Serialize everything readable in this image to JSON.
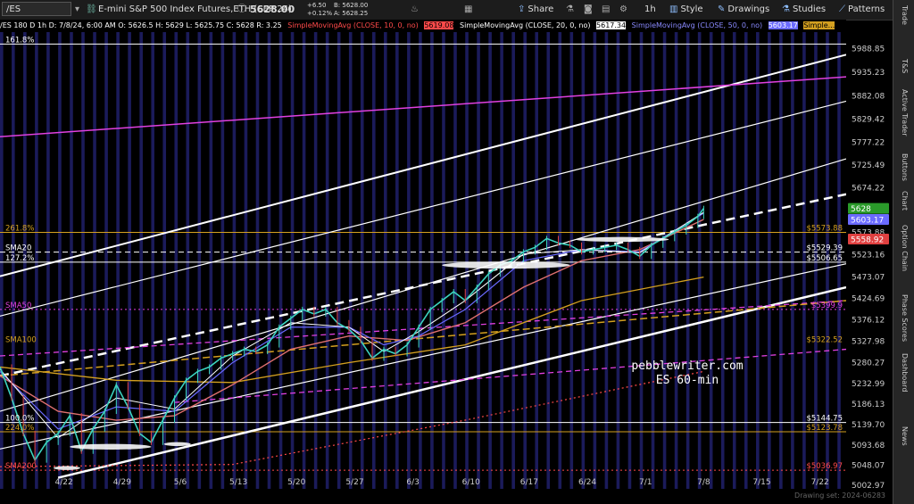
{
  "toolbar": {
    "symbol": "/ES",
    "description": "E-mini S&P 500 Index Futures,ETH (SEP 24)",
    "last_price": "5628.00",
    "change": "+6.50",
    "change_pct": "+0.12%",
    "bid": "B: 5628.00",
    "ask": "A: 5628.25",
    "share_label": "Share",
    "timeframe_label": "1h",
    "style_label": "Style",
    "drawings_label": "Drawings",
    "studies_label": "Studies",
    "patterns_label": "Patterns"
  },
  "infobar": {
    "ohlc": "/ES 180 D 1h   D: 7/8/24, 6:00 AM  O: 5626.5  H: 5629  L: 5625.75  C: 5628  R: 3.25",
    "sma10_label": "SimpleMovingAvg (CLOSE, 10, 0, no)",
    "sma10_value": "5619.08",
    "sma20_label": "SimpleMovingAvg (CLOSE, 20, 0, no)",
    "sma20_value": "5617.34",
    "sma50_label": "SimpleMovingAvg (CLOSE, 50, 0, no)",
    "sma50_value": "5603.17",
    "sma_more_label": "Simple..."
  },
  "right_tabs": [
    "Trade",
    "T&S",
    "Active Trader",
    "Buttons",
    "Chart",
    "Option Chain",
    "Phase Scores",
    "Dashboard",
    "News"
  ],
  "footer": {
    "drawing_set": "Drawing set: 2024-06283"
  },
  "colors": {
    "bg": "#000000",
    "stripe": "#1b1b5a",
    "white": "#ffffff",
    "magenta": "#e040e0",
    "gold": "#d4a020",
    "red": "#ff4a4a",
    "candle_up": "#3cd3c0",
    "candle_dn": "#e04040"
  },
  "chart_data": {
    "type": "line",
    "title": "",
    "watermark": [
      "pebblewriter.com",
      "ES 60-min"
    ],
    "x_ticks": [
      "4/22",
      "4/29",
      "5/6",
      "5/13",
      "5/20",
      "5/27",
      "6/3",
      "6/10",
      "6/17",
      "6/24",
      "7/1",
      "7/8",
      "7/15",
      "7/22"
    ],
    "x_tick_index": [
      11,
      21,
      31,
      41,
      51,
      61,
      71,
      81,
      91,
      101,
      111,
      121,
      131,
      141
    ],
    "y_axis_ticks": [
      5988.85,
      5935.23,
      5882.08,
      5829.42,
      5777.22,
      5725.49,
      5674.22,
      5623.41,
      5573.88,
      5523.16,
      5473.07,
      5424.69,
      5376.12,
      5327.98,
      5280.27,
      5232.99,
      5186.13,
      5139.7,
      5093.68,
      5048.07,
      5002.97
    ],
    "ylim": [
      4995,
      6026
    ],
    "xlim": [
      0,
      145.5
    ],
    "close_series": [
      {
        "x": 0,
        "y": 5270
      },
      {
        "x": 2,
        "y": 5200
      },
      {
        "x": 4,
        "y": 5120
      },
      {
        "x": 6,
        "y": 5060
      },
      {
        "x": 8,
        "y": 5100
      },
      {
        "x": 10,
        "y": 5120
      },
      {
        "x": 12,
        "y": 5160
      },
      {
        "x": 14,
        "y": 5080
      },
      {
        "x": 16,
        "y": 5130
      },
      {
        "x": 18,
        "y": 5170
      },
      {
        "x": 20,
        "y": 5230
      },
      {
        "x": 22,
        "y": 5180
      },
      {
        "x": 24,
        "y": 5120
      },
      {
        "x": 26,
        "y": 5100
      },
      {
        "x": 28,
        "y": 5150
      },
      {
        "x": 30,
        "y": 5200
      },
      {
        "x": 32,
        "y": 5240
      },
      {
        "x": 34,
        "y": 5260
      },
      {
        "x": 36,
        "y": 5270
      },
      {
        "x": 38,
        "y": 5290
      },
      {
        "x": 40,
        "y": 5300
      },
      {
        "x": 42,
        "y": 5310
      },
      {
        "x": 44,
        "y": 5305
      },
      {
        "x": 46,
        "y": 5320
      },
      {
        "x": 48,
        "y": 5360
      },
      {
        "x": 50,
        "y": 5380
      },
      {
        "x": 52,
        "y": 5400
      },
      {
        "x": 54,
        "y": 5390
      },
      {
        "x": 56,
        "y": 5400
      },
      {
        "x": 58,
        "y": 5370
      },
      {
        "x": 60,
        "y": 5355
      },
      {
        "x": 62,
        "y": 5330
      },
      {
        "x": 64,
        "y": 5290
      },
      {
        "x": 66,
        "y": 5310
      },
      {
        "x": 68,
        "y": 5300
      },
      {
        "x": 70,
        "y": 5320
      },
      {
        "x": 72,
        "y": 5360
      },
      {
        "x": 74,
        "y": 5400
      },
      {
        "x": 76,
        "y": 5420
      },
      {
        "x": 78,
        "y": 5440
      },
      {
        "x": 80,
        "y": 5420
      },
      {
        "x": 82,
        "y": 5450
      },
      {
        "x": 84,
        "y": 5480
      },
      {
        "x": 86,
        "y": 5500
      },
      {
        "x": 88,
        "y": 5510
      },
      {
        "x": 90,
        "y": 5530
      },
      {
        "x": 92,
        "y": 5540
      },
      {
        "x": 94,
        "y": 5560
      },
      {
        "x": 96,
        "y": 5550
      },
      {
        "x": 98,
        "y": 5545
      },
      {
        "x": 100,
        "y": 5530
      },
      {
        "x": 102,
        "y": 5535
      },
      {
        "x": 104,
        "y": 5540
      },
      {
        "x": 106,
        "y": 5545
      },
      {
        "x": 108,
        "y": 5535
      },
      {
        "x": 110,
        "y": 5520
      },
      {
        "x": 112,
        "y": 5545
      },
      {
        "x": 114,
        "y": 5560
      },
      {
        "x": 116,
        "y": 5575
      },
      {
        "x": 118,
        "y": 5590
      },
      {
        "x": 120,
        "y": 5610
      },
      {
        "x": 121,
        "y": 5628
      }
    ],
    "sma10": [
      {
        "x": 0,
        "y": 5265
      },
      {
        "x": 10,
        "y": 5110
      },
      {
        "x": 20,
        "y": 5200
      },
      {
        "x": 30,
        "y": 5175
      },
      {
        "x": 40,
        "y": 5295
      },
      {
        "x": 50,
        "y": 5370
      },
      {
        "x": 60,
        "y": 5360
      },
      {
        "x": 66,
        "y": 5305
      },
      {
        "x": 72,
        "y": 5350
      },
      {
        "x": 80,
        "y": 5420
      },
      {
        "x": 90,
        "y": 5525
      },
      {
        "x": 100,
        "y": 5535
      },
      {
        "x": 110,
        "y": 5528
      },
      {
        "x": 121,
        "y": 5619.08
      }
    ],
    "sma20": [
      {
        "x": 0,
        "y": 5260
      },
      {
        "x": 10,
        "y": 5130
      },
      {
        "x": 20,
        "y": 5180
      },
      {
        "x": 30,
        "y": 5170
      },
      {
        "x": 40,
        "y": 5280
      },
      {
        "x": 50,
        "y": 5360
      },
      {
        "x": 60,
        "y": 5360
      },
      {
        "x": 66,
        "y": 5320
      },
      {
        "x": 72,
        "y": 5340
      },
      {
        "x": 80,
        "y": 5400
      },
      {
        "x": 90,
        "y": 5510
      },
      {
        "x": 100,
        "y": 5535
      },
      {
        "x": 110,
        "y": 5530
      },
      {
        "x": 121,
        "y": 5617.34
      }
    ],
    "sma50": [
      {
        "x": 0,
        "y": 5250
      },
      {
        "x": 10,
        "y": 5170
      },
      {
        "x": 20,
        "y": 5150
      },
      {
        "x": 30,
        "y": 5160
      },
      {
        "x": 40,
        "y": 5230
      },
      {
        "x": 50,
        "y": 5310
      },
      {
        "x": 60,
        "y": 5340
      },
      {
        "x": 70,
        "y": 5330
      },
      {
        "x": 80,
        "y": 5370
      },
      {
        "x": 90,
        "y": 5450
      },
      {
        "x": 100,
        "y": 5510
      },
      {
        "x": 110,
        "y": 5535
      },
      {
        "x": 121,
        "y": 5603.17
      }
    ],
    "sma100": [
      {
        "x": 0,
        "y": 5270
      },
      {
        "x": 20,
        "y": 5240
      },
      {
        "x": 40,
        "y": 5235
      },
      {
        "x": 60,
        "y": 5280
      },
      {
        "x": 80,
        "y": 5320
      },
      {
        "x": 100,
        "y": 5420
      },
      {
        "x": 121,
        "y": 5473
      }
    ],
    "sma200": [
      {
        "x": 0,
        "y": 5045
      },
      {
        "x": 40,
        "y": 5050
      },
      {
        "x": 80,
        "y": 5150
      },
      {
        "x": 121,
        "y": 5260
      }
    ],
    "horizontal_levels": [
      {
        "label": "261.8%",
        "price_label": "$5573.88",
        "y": 5573.88,
        "color": "#d4a020",
        "side": "left",
        "style": "solid"
      },
      {
        "label": "SMA20",
        "price_label": "$5529.39",
        "y": 5529.39,
        "color": "#ffffff",
        "side": "left",
        "style": "dash"
      },
      {
        "label": "127.2%",
        "price_label": "$5506.65",
        "y": 5506.65,
        "color": "#ffffff",
        "side": "left",
        "style": "solid"
      },
      {
        "label": "SMA50",
        "price_label": "$5399.9",
        "y": 5399.9,
        "color": "#e040e0",
        "side": "left",
        "style": "dot"
      },
      {
        "label": "SMA100",
        "price_label": "$5322.52",
        "y": 5322.52,
        "color": "#d4a020",
        "side": "left",
        "style": "none"
      },
      {
        "label": "100.0%",
        "price_label": "$5144.75",
        "y": 5144.75,
        "color": "#ffffff",
        "side": "left",
        "style": "solid"
      },
      {
        "label": "224.0%",
        "price_label": "$5123.78",
        "y": 5123.78,
        "color": "#d4a020",
        "side": "left",
        "style": "solid"
      },
      {
        "label": "SMA200",
        "price_label": "$5036.97",
        "y": 5036.97,
        "color": "#ff4a4a",
        "side": "left",
        "style": "dot"
      },
      {
        "label": "161.8%",
        "price_label": "",
        "y": 5999,
        "color": "#ffffff",
        "side": "left",
        "style": "solid"
      }
    ],
    "price_badges": [
      {
        "text": "5628",
        "y": 5628,
        "bg": "#2a9a2a"
      },
      {
        "text": "5603.17",
        "y": 5603.17,
        "bg": "#6a6aff"
      },
      {
        "text": "5558.92",
        "y": 5558.92,
        "bg": "#e04040"
      }
    ],
    "channel_lines": [
      {
        "from": [
          0,
          5475
        ],
        "to": [
          145.5,
          5975
        ],
        "color": "#ffffff",
        "width": 2,
        "dash": "none"
      },
      {
        "from": [
          0,
          5250
        ],
        "to": [
          145.5,
          5660
        ],
        "color": "#ffffff",
        "width": 2.5,
        "dash": "10,6"
      },
      {
        "from": [
          0,
          5385
        ],
        "to": [
          145.5,
          5870
        ],
        "color": "#ffffff",
        "width": 1.2,
        "dash": "none"
      },
      {
        "from": [
          0,
          5170
        ],
        "to": [
          145.5,
          5740
        ],
        "color": "#ffffff",
        "width": 1.2,
        "dash": "none"
      },
      {
        "from": [
          0,
          5085
        ],
        "to": [
          145.5,
          5503
        ],
        "color": "#ffffff",
        "width": 1.2,
        "dash": "none"
      },
      {
        "from": [
          10,
          5020
        ],
        "to": [
          145.5,
          5450
        ],
        "color": "#ffffff",
        "width": 2.5,
        "dash": "none"
      },
      {
        "from": [
          0,
          5790
        ],
        "to": [
          145.5,
          5925
        ],
        "color": "#e040e0",
        "width": 1.5,
        "dash": "none"
      },
      {
        "from": [
          0,
          5295
        ],
        "to": [
          145.5,
          5420
        ],
        "color": "#e040e0",
        "width": 1.3,
        "dash": "6,4"
      },
      {
        "from": [
          30,
          5190
        ],
        "to": [
          145.5,
          5310
        ],
        "color": "#e040e0",
        "width": 1.3,
        "dash": "6,4"
      },
      {
        "from": [
          0,
          5250
        ],
        "to": [
          145.5,
          5420
        ],
        "color": "#d4a020",
        "width": 1.5,
        "dash": "8,4"
      }
    ],
    "highlight_ellipses": [
      {
        "cx": 19,
        "cy": 5090,
        "rx": 7,
        "ry": 26
      },
      {
        "cx": 30.5,
        "cy": 5096,
        "rx": 2.3,
        "ry": 18
      },
      {
        "cx": 11.5,
        "cy": 5042,
        "rx": 2.3,
        "ry": 18
      },
      {
        "cx": 87,
        "cy": 5500,
        "rx": 11,
        "ry": 32
      },
      {
        "cx": 107,
        "cy": 5558,
        "rx": 8,
        "ry": 22
      },
      {
        "cx": 158,
        "cy": 5575,
        "rx": 2.3,
        "ry": 16
      },
      {
        "cx": 158,
        "cy": 5508,
        "rx": 2.3,
        "ry": 16
      },
      {
        "cx": 172,
        "cy": 5955,
        "rx": 13,
        "ry": 28
      }
    ]
  }
}
